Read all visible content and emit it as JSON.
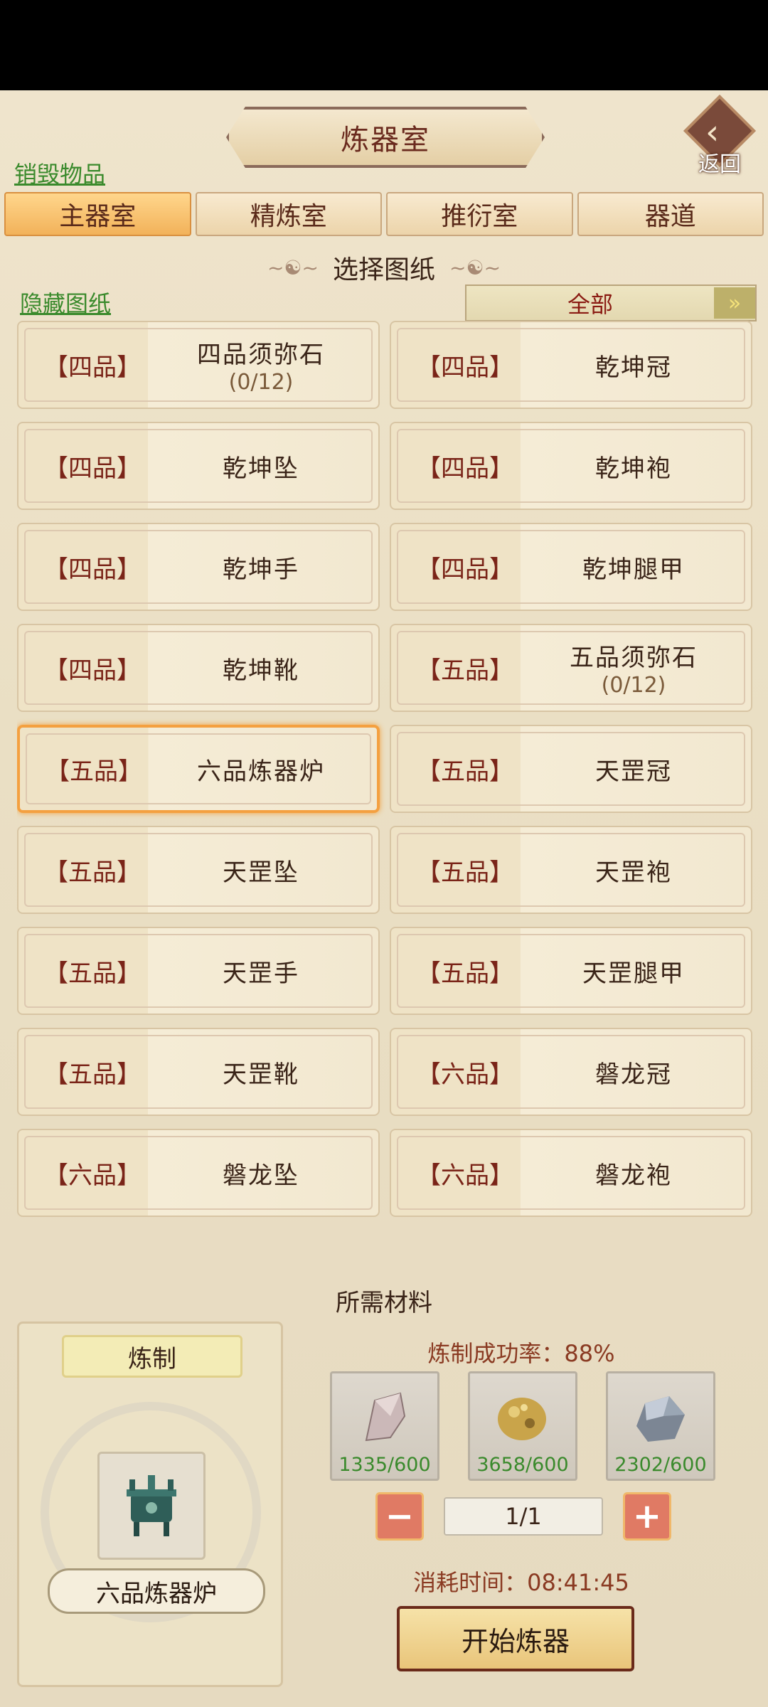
{
  "header": {
    "title": "炼器室",
    "back_label": "返回",
    "destroy_link": "销毁物品"
  },
  "tabs": [
    "主器室",
    "精炼室",
    "推衍室",
    "器道"
  ],
  "active_tab": 0,
  "blueprint_section": {
    "title": "选择图纸",
    "hide_link": "隐藏图纸",
    "filter_value": "全部"
  },
  "blueprints": [
    {
      "grade": "【四品】",
      "name": "四品须弥石",
      "count": "(0/12)"
    },
    {
      "grade": "【四品】",
      "name": "乾坤冠"
    },
    {
      "grade": "【四品】",
      "name": "乾坤坠"
    },
    {
      "grade": "【四品】",
      "name": "乾坤袍"
    },
    {
      "grade": "【四品】",
      "name": "乾坤手"
    },
    {
      "grade": "【四品】",
      "name": "乾坤腿甲"
    },
    {
      "grade": "【四品】",
      "name": "乾坤靴"
    },
    {
      "grade": "【五品】",
      "name": "五品须弥石",
      "count": "(0/12)"
    },
    {
      "grade": "【五品】",
      "name": "六品炼器炉",
      "selected": true
    },
    {
      "grade": "【五品】",
      "name": "天罡冠"
    },
    {
      "grade": "【五品】",
      "name": "天罡坠"
    },
    {
      "grade": "【五品】",
      "name": "天罡袍"
    },
    {
      "grade": "【五品】",
      "name": "天罡手"
    },
    {
      "grade": "【五品】",
      "name": "天罡腿甲"
    },
    {
      "grade": "【五品】",
      "name": "天罡靴"
    },
    {
      "grade": "【六品】",
      "name": "磐龙冠"
    },
    {
      "grade": "【六品】",
      "name": "磐龙坠"
    },
    {
      "grade": "【六品】",
      "name": "磐龙袍"
    }
  ],
  "materials_section": {
    "title": "所需材料",
    "craft_label": "炼制",
    "item_name": "六品炼器炉",
    "success_rate": "炼制成功率：88%",
    "materials": [
      {
        "icon": "pink-crystal-icon",
        "qty": "1335/600"
      },
      {
        "icon": "gold-ore-icon",
        "qty": "3658/600"
      },
      {
        "icon": "silver-ore-icon",
        "qty": "2302/600"
      }
    ],
    "quantity": "1/1",
    "time": "消耗时间：08:41:45",
    "start_button": "开始炼器"
  }
}
